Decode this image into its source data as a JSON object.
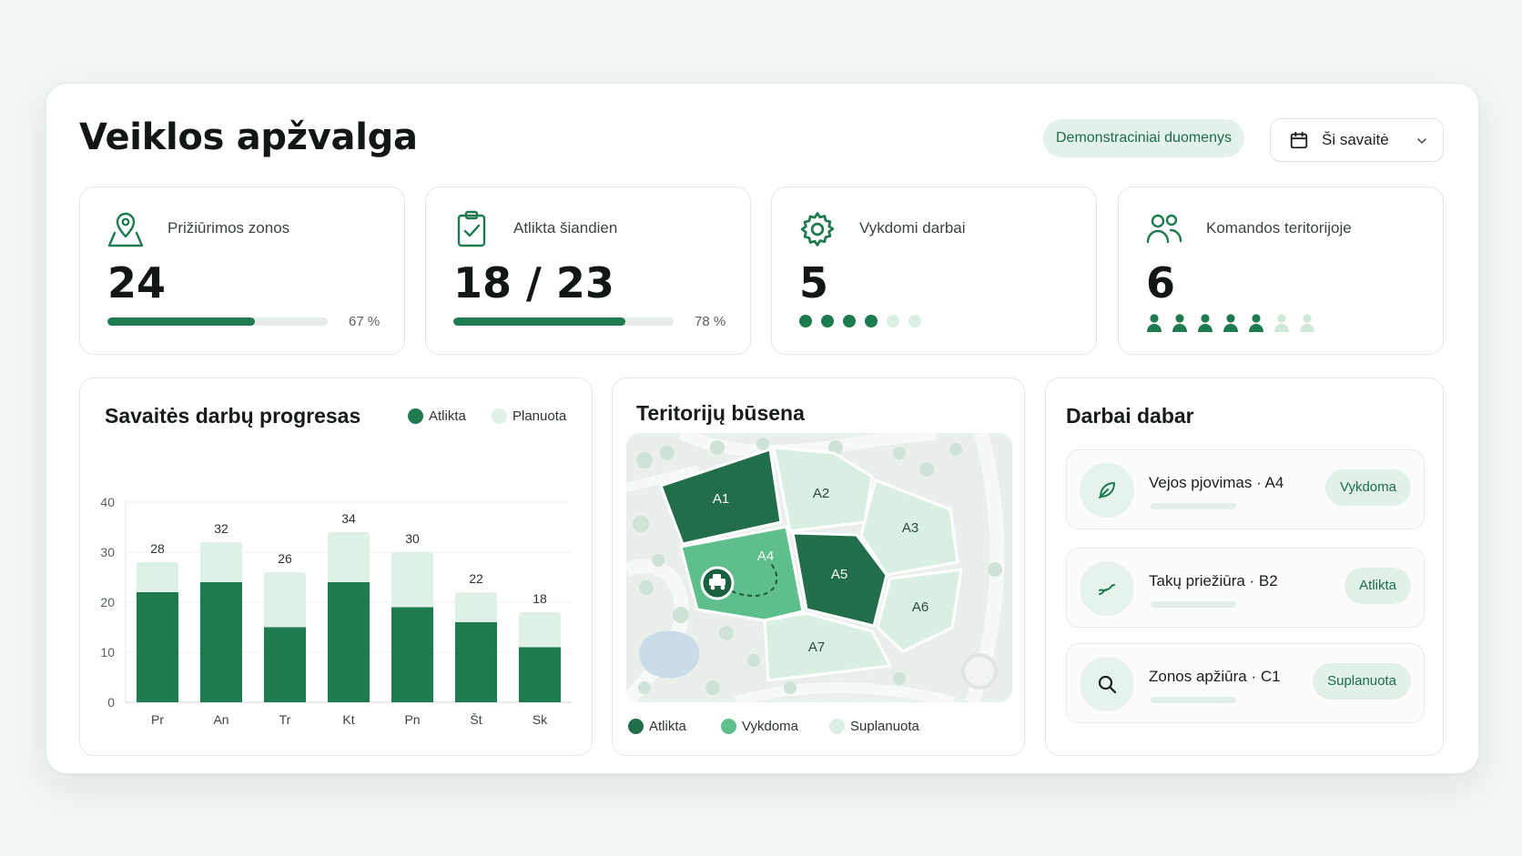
{
  "header": {
    "title": "Veiklos apžvalga",
    "demo_badge": "Demonstraciniai duomenys",
    "period_select": "Ši savaitė"
  },
  "kpis": [
    {
      "label": "Prižiūrimos zonos",
      "value": "24",
      "progress_pct_label": "67 %",
      "progress": 0.67,
      "icon": "map-pin-icon"
    },
    {
      "label": "Atlikta šiandien",
      "value": "18 / 23",
      "progress_pct_label": "78 %",
      "progress": 0.78,
      "icon": "clipboard-check-icon"
    },
    {
      "label": "Vykdomi darbai",
      "value": "5",
      "active_dots": 4,
      "total_dots": 6,
      "icon": "gear-icon"
    },
    {
      "label": "Komandos teritorijoje",
      "value": "6",
      "active_people": 5,
      "total_people": 7,
      "icon": "users-icon"
    }
  ],
  "weekly": {
    "title": "Savaitės darbų progresas",
    "legend_done": "Atlikta",
    "legend_planned": "Planuota"
  },
  "chart_data": {
    "type": "bar",
    "categories": [
      "Pr",
      "An",
      "Tr",
      "Kt",
      "Pn",
      "Št",
      "Sk"
    ],
    "series": [
      {
        "name": "Atlikta",
        "values": [
          22,
          24,
          15,
          24,
          19,
          16,
          11
        ]
      },
      {
        "name": "Planuota",
        "values": [
          28,
          32,
          26,
          34,
          30,
          22,
          18
        ]
      }
    ],
    "totals": [
      28,
      32,
      26,
      34,
      30,
      22,
      18
    ],
    "ylim": [
      0,
      40
    ],
    "yticks": [
      0,
      10,
      20,
      30,
      40
    ],
    "grid": true,
    "legend": "top-right",
    "colors": {
      "done": "#1e7a4f",
      "planned": "#dff0e6"
    }
  },
  "territory": {
    "title": "Teritorijų būsena",
    "zones": [
      {
        "id": "A1",
        "status": "done"
      },
      {
        "id": "A2",
        "status": "planned"
      },
      {
        "id": "A3",
        "status": "planned"
      },
      {
        "id": "A4",
        "status": "in_progress"
      },
      {
        "id": "A5",
        "status": "done"
      },
      {
        "id": "A6",
        "status": "planned"
      },
      {
        "id": "A7",
        "status": "planned"
      }
    ],
    "legend_done": "Atlikta",
    "legend_progress": "Vykdoma",
    "legend_planned": "Suplanuota",
    "colors": {
      "done": "#236e4a",
      "in_progress": "#5fbf8c",
      "planned": "#d8efe2"
    }
  },
  "jobs": {
    "title": "Darbai dabar",
    "items": [
      {
        "name": "Vejos pjovimas · A4",
        "status": "Vykdoma",
        "icon": "leaf-icon"
      },
      {
        "name": "Takų priežiūra · B2",
        "status": "Atlikta",
        "icon": "path-icon"
      },
      {
        "name": "Zonos apžiūra · C1",
        "status": "Suplanuota",
        "icon": "search-icon"
      }
    ]
  }
}
